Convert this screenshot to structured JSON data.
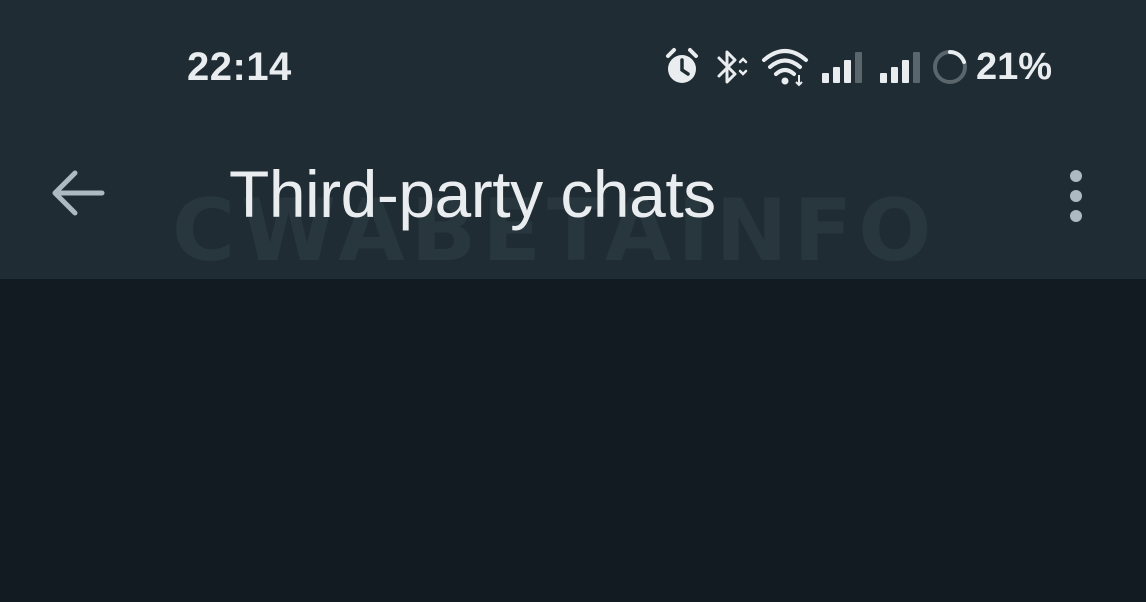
{
  "status_bar": {
    "time": "22:14",
    "battery_percent": "21%",
    "icons": [
      "alarm-icon",
      "bluetooth-icon",
      "wifi-icon",
      "signal-1-icon",
      "signal-2-icon",
      "battery-ring-icon"
    ]
  },
  "app_bar": {
    "title": "Third-party chats",
    "watermark": "CWABETAINFO",
    "back_icon": "arrow-back-icon",
    "menu_icon": "more-vert-icon"
  },
  "colors": {
    "app_bar_bg": "#202c33",
    "content_bg": "#111b21",
    "text_primary": "#e9edef",
    "icon_color": "#aebac1"
  }
}
